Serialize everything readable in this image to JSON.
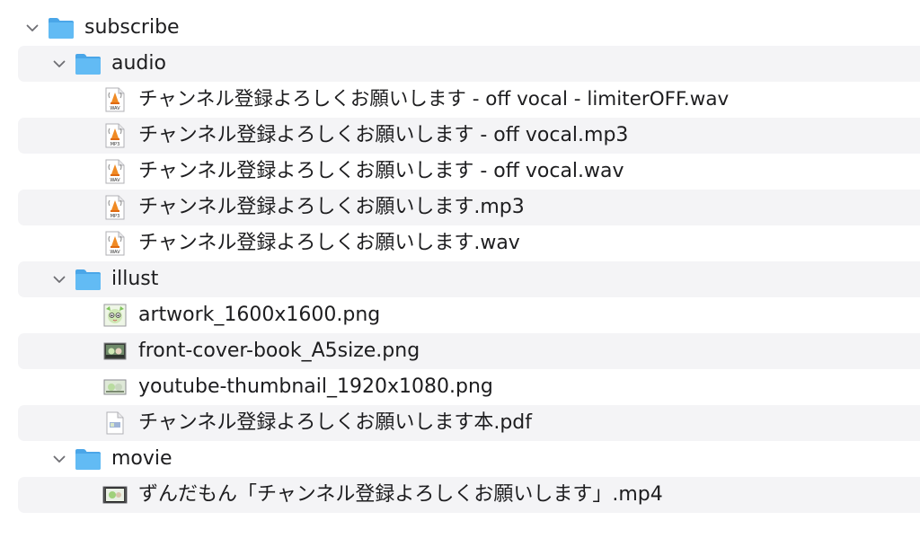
{
  "tree": {
    "root": {
      "name": "subscribe",
      "expanded": true,
      "folders": [
        {
          "name": "audio",
          "expanded": true,
          "files": [
            {
              "name": "チャンネル登録よろしくお願いします - off vocal - limiterOFF.wav",
              "icon": "wav-file-icon",
              "badge": "WAV"
            },
            {
              "name": "チャンネル登録よろしくお願いします - off vocal.mp3",
              "icon": "mp3-file-icon",
              "badge": "MP3"
            },
            {
              "name": "チャンネル登録よろしくお願いします - off vocal.wav",
              "icon": "wav-file-icon",
              "badge": "WAV"
            },
            {
              "name": "チャンネル登録よろしくお願いします.mp3",
              "icon": "mp3-file-icon",
              "badge": "MP3"
            },
            {
              "name": "チャンネル登録よろしくお願いします.wav",
              "icon": "wav-file-icon",
              "badge": "WAV"
            }
          ]
        },
        {
          "name": "illust",
          "expanded": true,
          "files": [
            {
              "name": "artwork_1600x1600.png",
              "icon": "image-thumbnail-icon"
            },
            {
              "name": "front-cover-book_A5size.png",
              "icon": "image-thumbnail-icon"
            },
            {
              "name": "youtube-thumbnail_1920x1080.png",
              "icon": "image-thumbnail-icon"
            },
            {
              "name": "チャンネル登録よろしくお願いします本.pdf",
              "icon": "pdf-file-icon"
            }
          ]
        },
        {
          "name": "movie",
          "expanded": true,
          "files": [
            {
              "name": "ずんだもん「チャンネル登録よろしくお願いします」.mp4",
              "icon": "video-thumbnail-icon"
            }
          ]
        }
      ]
    }
  },
  "colors": {
    "folder_body": "#5fb7f2",
    "folder_tab": "#4aa6e8",
    "row_stripe": "#f4f4f6",
    "chevron": "#6e6e73",
    "vlc_orange": "#f08a24"
  }
}
